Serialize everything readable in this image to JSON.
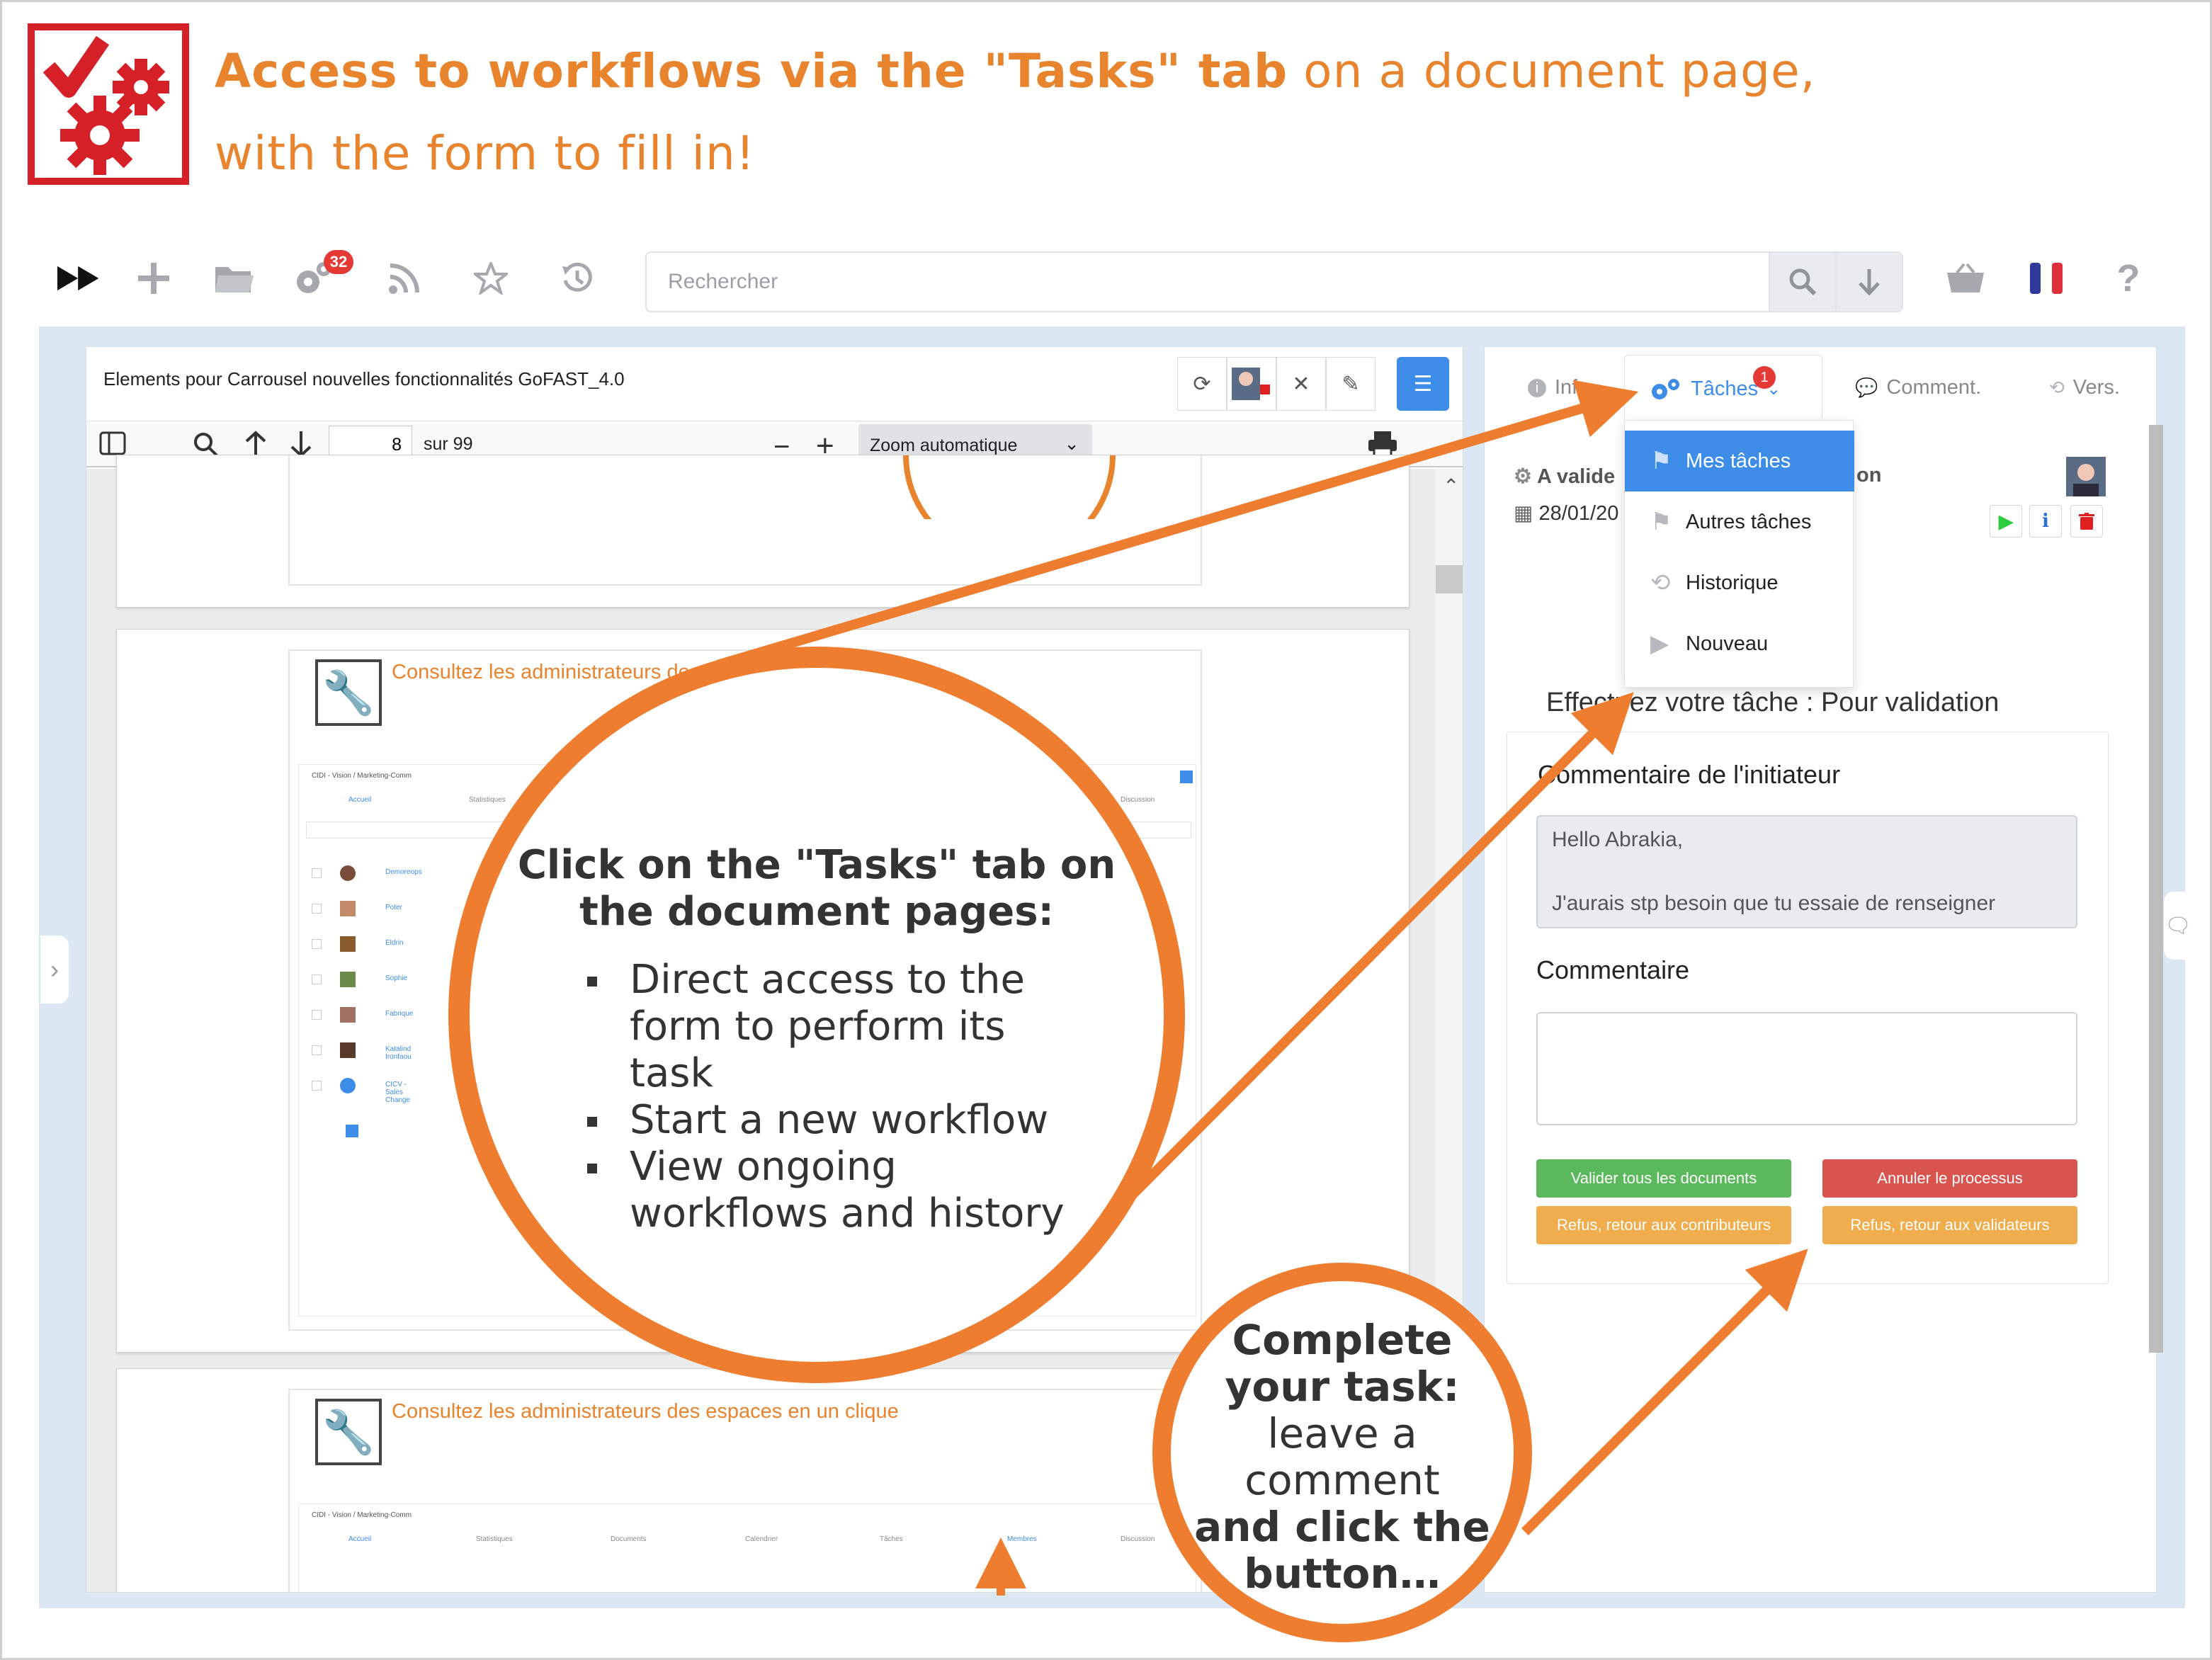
{
  "header": {
    "headline_bold": "Access to workflows via the \"Tasks\" tab",
    "headline_rest": " on a document page,",
    "headline_line2": "with the form to fill in!"
  },
  "toolbar": {
    "notification_count": "32",
    "search_placeholder": "Rechercher"
  },
  "viewer": {
    "title": "Elements pour Carrousel nouvelles fonctionnalités GoFAST_4.0",
    "page_number": "8",
    "page_total": "sur 99",
    "zoom_label": "Zoom automatique",
    "slide_title_1": "Consultez les administrateurs des espaces en un clique",
    "slide_title_2": "Consultez les administrateurs des espaces en un clique",
    "mini_rows": [
      "Demoreops",
      "Poter",
      "Eldrin",
      "Sophie",
      "Fabrique",
      "Katalind Ironfaou",
      "CICV - Sales Change"
    ],
    "mini_header_1": "CIDI - Vision / Marketing-Comm",
    "mini_header_2": "CIDI - Vision / Marketing-Comm",
    "mini_tabs": [
      "Accueil",
      "Statistiques",
      "Documents",
      "Calendrier",
      "Tâches",
      "Membres",
      "Discussion"
    ]
  },
  "panel": {
    "tabs": {
      "info": "Info",
      "taches": "Tâches",
      "taches_badge": "1",
      "comment": "Comment.",
      "vers": "Vers."
    },
    "dropdown": [
      "Mes tâches",
      "Autres tâches",
      "Historique",
      "Nouveau"
    ],
    "task_name": "A valide",
    "task_name_suffix": "on",
    "task_date": "28/01/20",
    "task_heading": "Effectuez votre tâche : Pour validation",
    "initiator_label": "Commentaire de l'initiateur",
    "initiator_line1": "Hello Abrakia,",
    "initiator_line2": "J'aurais stp besoin que tu essaie de renseigner",
    "comment_label": "Commentaire",
    "comment_value": "",
    "buttons": {
      "validate": "Valider tous les documents",
      "cancel": "Annuler le processus",
      "refuse_contrib": "Refus, retour aux contributeurs",
      "refuse_valid": "Refus, retour aux validateurs"
    }
  },
  "callouts": {
    "big_heading_1": "Click on the \"Tasks\" tab on",
    "big_heading_2": "the document pages:",
    "bullets": [
      "Direct access to the form to perform its task",
      "Start a new workflow",
      "View ongoing workflows and history"
    ],
    "small_line1": "Complete",
    "small_line2": "your task:",
    "small_line3": "leave a",
    "small_line4": "comment",
    "small_line5": "and click the",
    "small_line6": "button…"
  },
  "colors": {
    "accent_orange": "#e8832e",
    "logo_red": "#d62027",
    "primary_blue": "#3d8de8",
    "success_green": "#5cb85c",
    "danger_red": "#d9534f",
    "warning_orange": "#f0ad4e"
  }
}
